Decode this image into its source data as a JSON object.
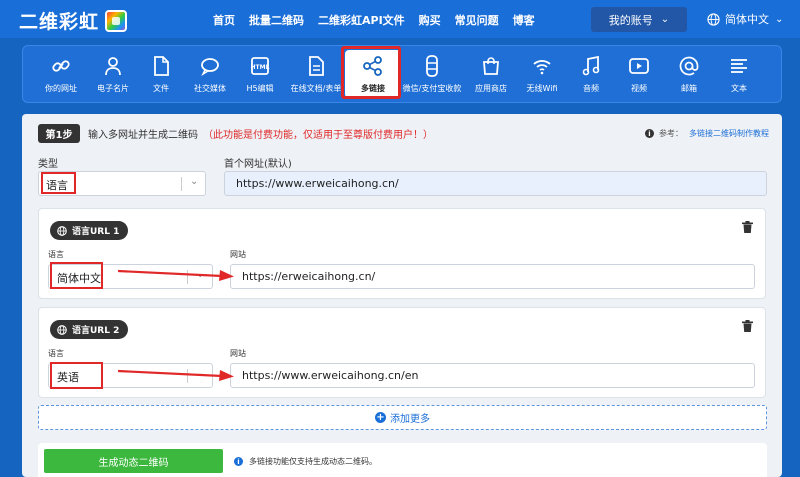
{
  "header": {
    "brand": "二维彩虹",
    "nav": [
      "首页",
      "批量二维码",
      "二维彩虹API文件",
      "购买",
      "常见问题",
      "博客"
    ],
    "account": "我的账号",
    "language": "简体中文"
  },
  "categories": [
    {
      "label": "你的网址",
      "icon": "link-icon"
    },
    {
      "label": "电子名片",
      "icon": "person-icon"
    },
    {
      "label": "文件",
      "icon": "file-icon"
    },
    {
      "label": "社交媒体",
      "icon": "chat-bubble-icon"
    },
    {
      "label": "H5编辑",
      "icon": "html-icon"
    },
    {
      "label": "在线文档/表单",
      "icon": "document-icon"
    },
    {
      "label": "多链接",
      "icon": "share-icon",
      "active": true
    },
    {
      "label": "微信/支付宝收款",
      "icon": "payment-icon"
    },
    {
      "label": "应用商店",
      "icon": "store-bag-icon"
    },
    {
      "label": "无线Wifi",
      "icon": "wifi-icon"
    },
    {
      "label": "音频",
      "icon": "music-icon"
    },
    {
      "label": "视频",
      "icon": "video-icon"
    },
    {
      "label": "邮箱",
      "icon": "at-icon"
    },
    {
      "label": "文本",
      "icon": "text-icon"
    }
  ],
  "step": {
    "badge": "第1步",
    "title": "输入多网址并生成二维码",
    "note": "（此功能是付费功能，仅适用于至尊版付费用户！）",
    "ref_label": "参考：",
    "ref_link": "多链接二维码制作教程"
  },
  "form": {
    "type_label": "类型",
    "type_value": "语言",
    "first_url_label": "首个网址(默认)",
    "first_url_value": "https://www.erweicaihong.cn/"
  },
  "entries": [
    {
      "badge": "语言URL 1",
      "lang_label": "语言",
      "lang_value": "简体中文",
      "site_label": "网站",
      "site_value": "https://erweicaihong.cn/"
    },
    {
      "badge": "语言URL 2",
      "lang_label": "语言",
      "lang_value": "英语",
      "site_label": "网站",
      "site_value": "https://www.erweicaihong.cn/en"
    }
  ],
  "add_more": "添加更多",
  "generate_button": "生成动态二维码",
  "generate_note": "多链接功能仅支持生成动态二维码。",
  "colors": {
    "nav_blue": "#1a6ed8",
    "highlight_red": "#e02828",
    "generate_green": "#3cb83e"
  }
}
